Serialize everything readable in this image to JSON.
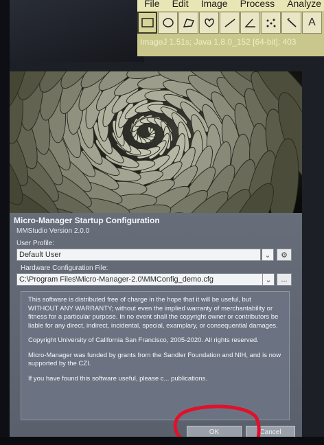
{
  "imagej": {
    "menus": [
      "File",
      "Edit",
      "Image",
      "Process",
      "Analyze"
    ],
    "tools": [
      {
        "icon": "rectangle-select-icon",
        "active": true
      },
      {
        "icon": "oval-select-icon"
      },
      {
        "icon": "polygon-select-icon"
      },
      {
        "icon": "freehand-select-icon"
      },
      {
        "icon": "line-select-icon"
      },
      {
        "icon": "angle-tool-icon"
      },
      {
        "icon": "multipoint-tool-icon"
      },
      {
        "icon": "wand-tool-icon"
      },
      {
        "icon": "text-tool-icon",
        "glyph": "A"
      }
    ],
    "status": "ImageJ 1.51s; Java 1.8.0_152 [64-bit]; 403"
  },
  "dialog": {
    "title": "Micro-Manager Startup Configuration",
    "version": "MMStudio Version 2.0.0",
    "user_profile": {
      "label": "User Profile:",
      "value": "Default User"
    },
    "hardware_config": {
      "label": "Hardware Configuration File:",
      "value": "C:\\Program Files\\Micro-Manager-2.0\\MMConfig_demo.cfg",
      "browse_label": "..."
    },
    "license_paragraphs": [
      "This software is distributed free of charge in the hope that it will be useful, but WITHOUT ANY WARRANTY; without even the implied warranty of merchantability or fitness for a particular purpose. In no event shall the copyright owner or contributors be liable for any direct, indirect, incidental, special, examplary, or consequential damages.",
      "Copyright University of California San Francisco, 2005-2020. All rights reserved.",
      "Micro-Manager was funded by grants from the Sandler Foundation and NIH, and is now supported by the CZI.",
      "If you have found this software useful, please c... publications."
    ],
    "ok_label": "OK",
    "cancel_label": "Cancel"
  },
  "colors": {
    "annotation": "#e0112a",
    "dialog_bg": "#666d79",
    "imagej_bg": "#c9c78c"
  }
}
